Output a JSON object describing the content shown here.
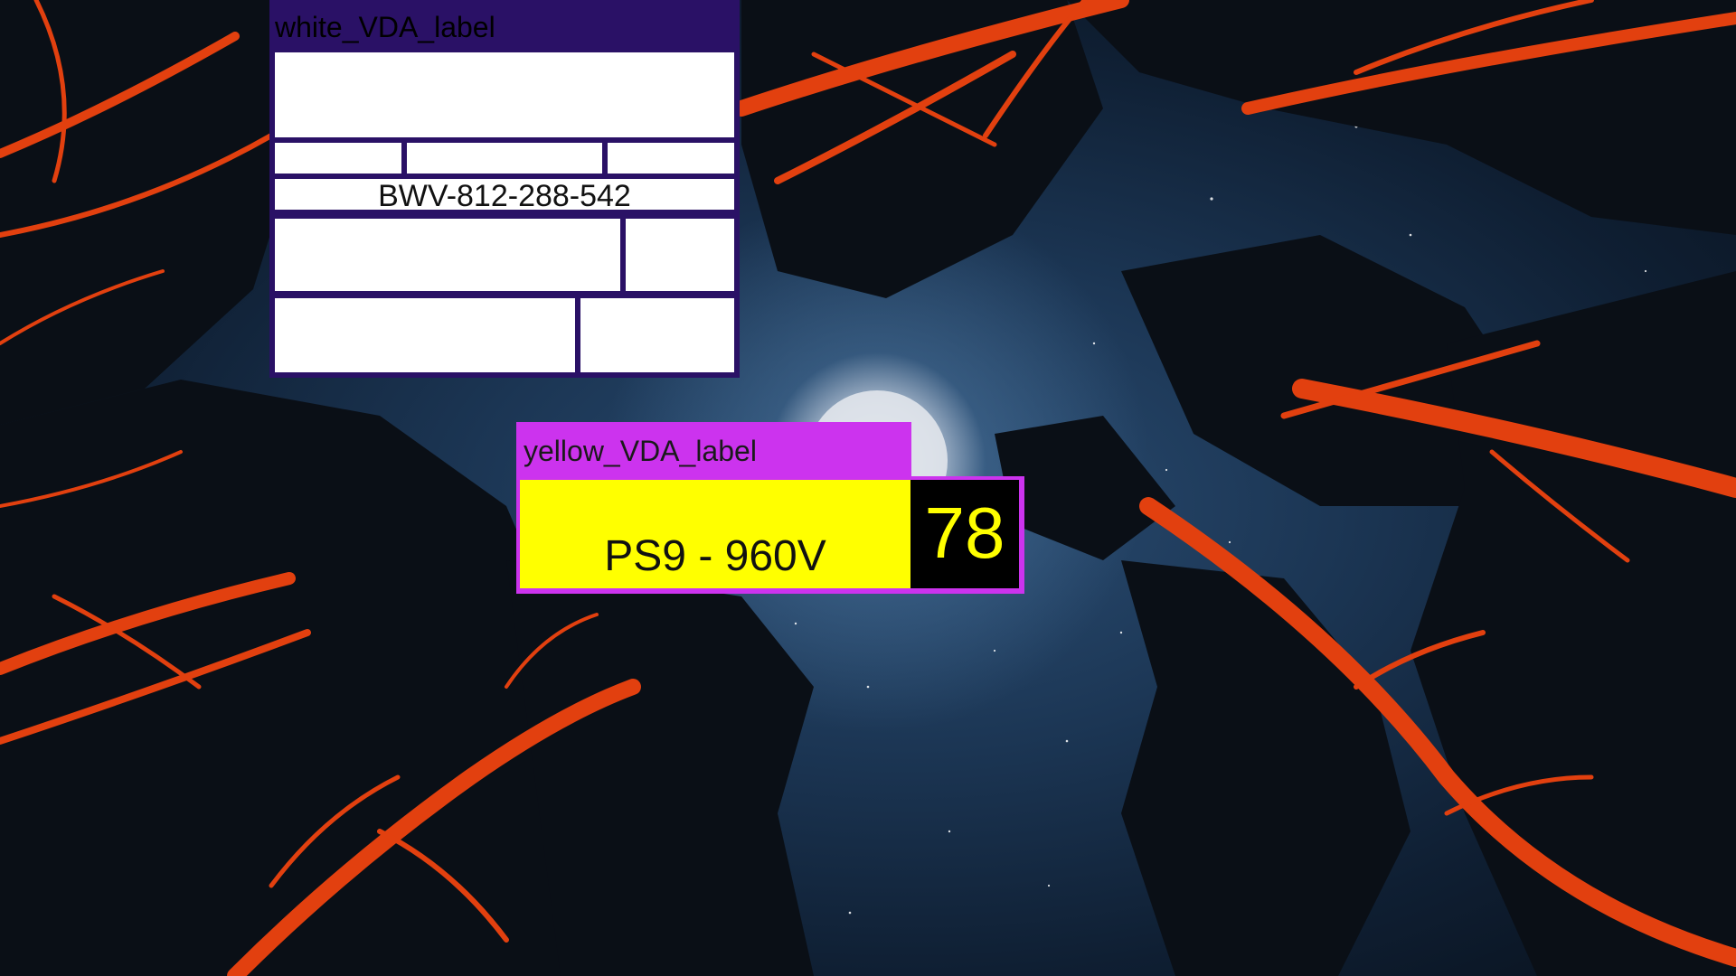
{
  "background": {
    "scene": "night-sky-forest-moon",
    "colors": {
      "sky": "#1b3553",
      "moon": "#dfe4ea",
      "branches": "#e2400f",
      "tree_shadow": "#0a0f16"
    }
  },
  "white_label": {
    "title": "white_VDA_label",
    "barcode_text": "BWV-812-288-542",
    "colors": {
      "title_bar": "#2a1166",
      "field": "#ffffff",
      "divider": "#000000"
    }
  },
  "yellow_label": {
    "title": "yellow_VDA_label",
    "part_text": "PS9 - 960V",
    "number": "78",
    "colors": {
      "title_bar": "#cc33ee",
      "field": "#ffff00",
      "number_bg": "#000000",
      "number_text": "#ffff00"
    }
  }
}
